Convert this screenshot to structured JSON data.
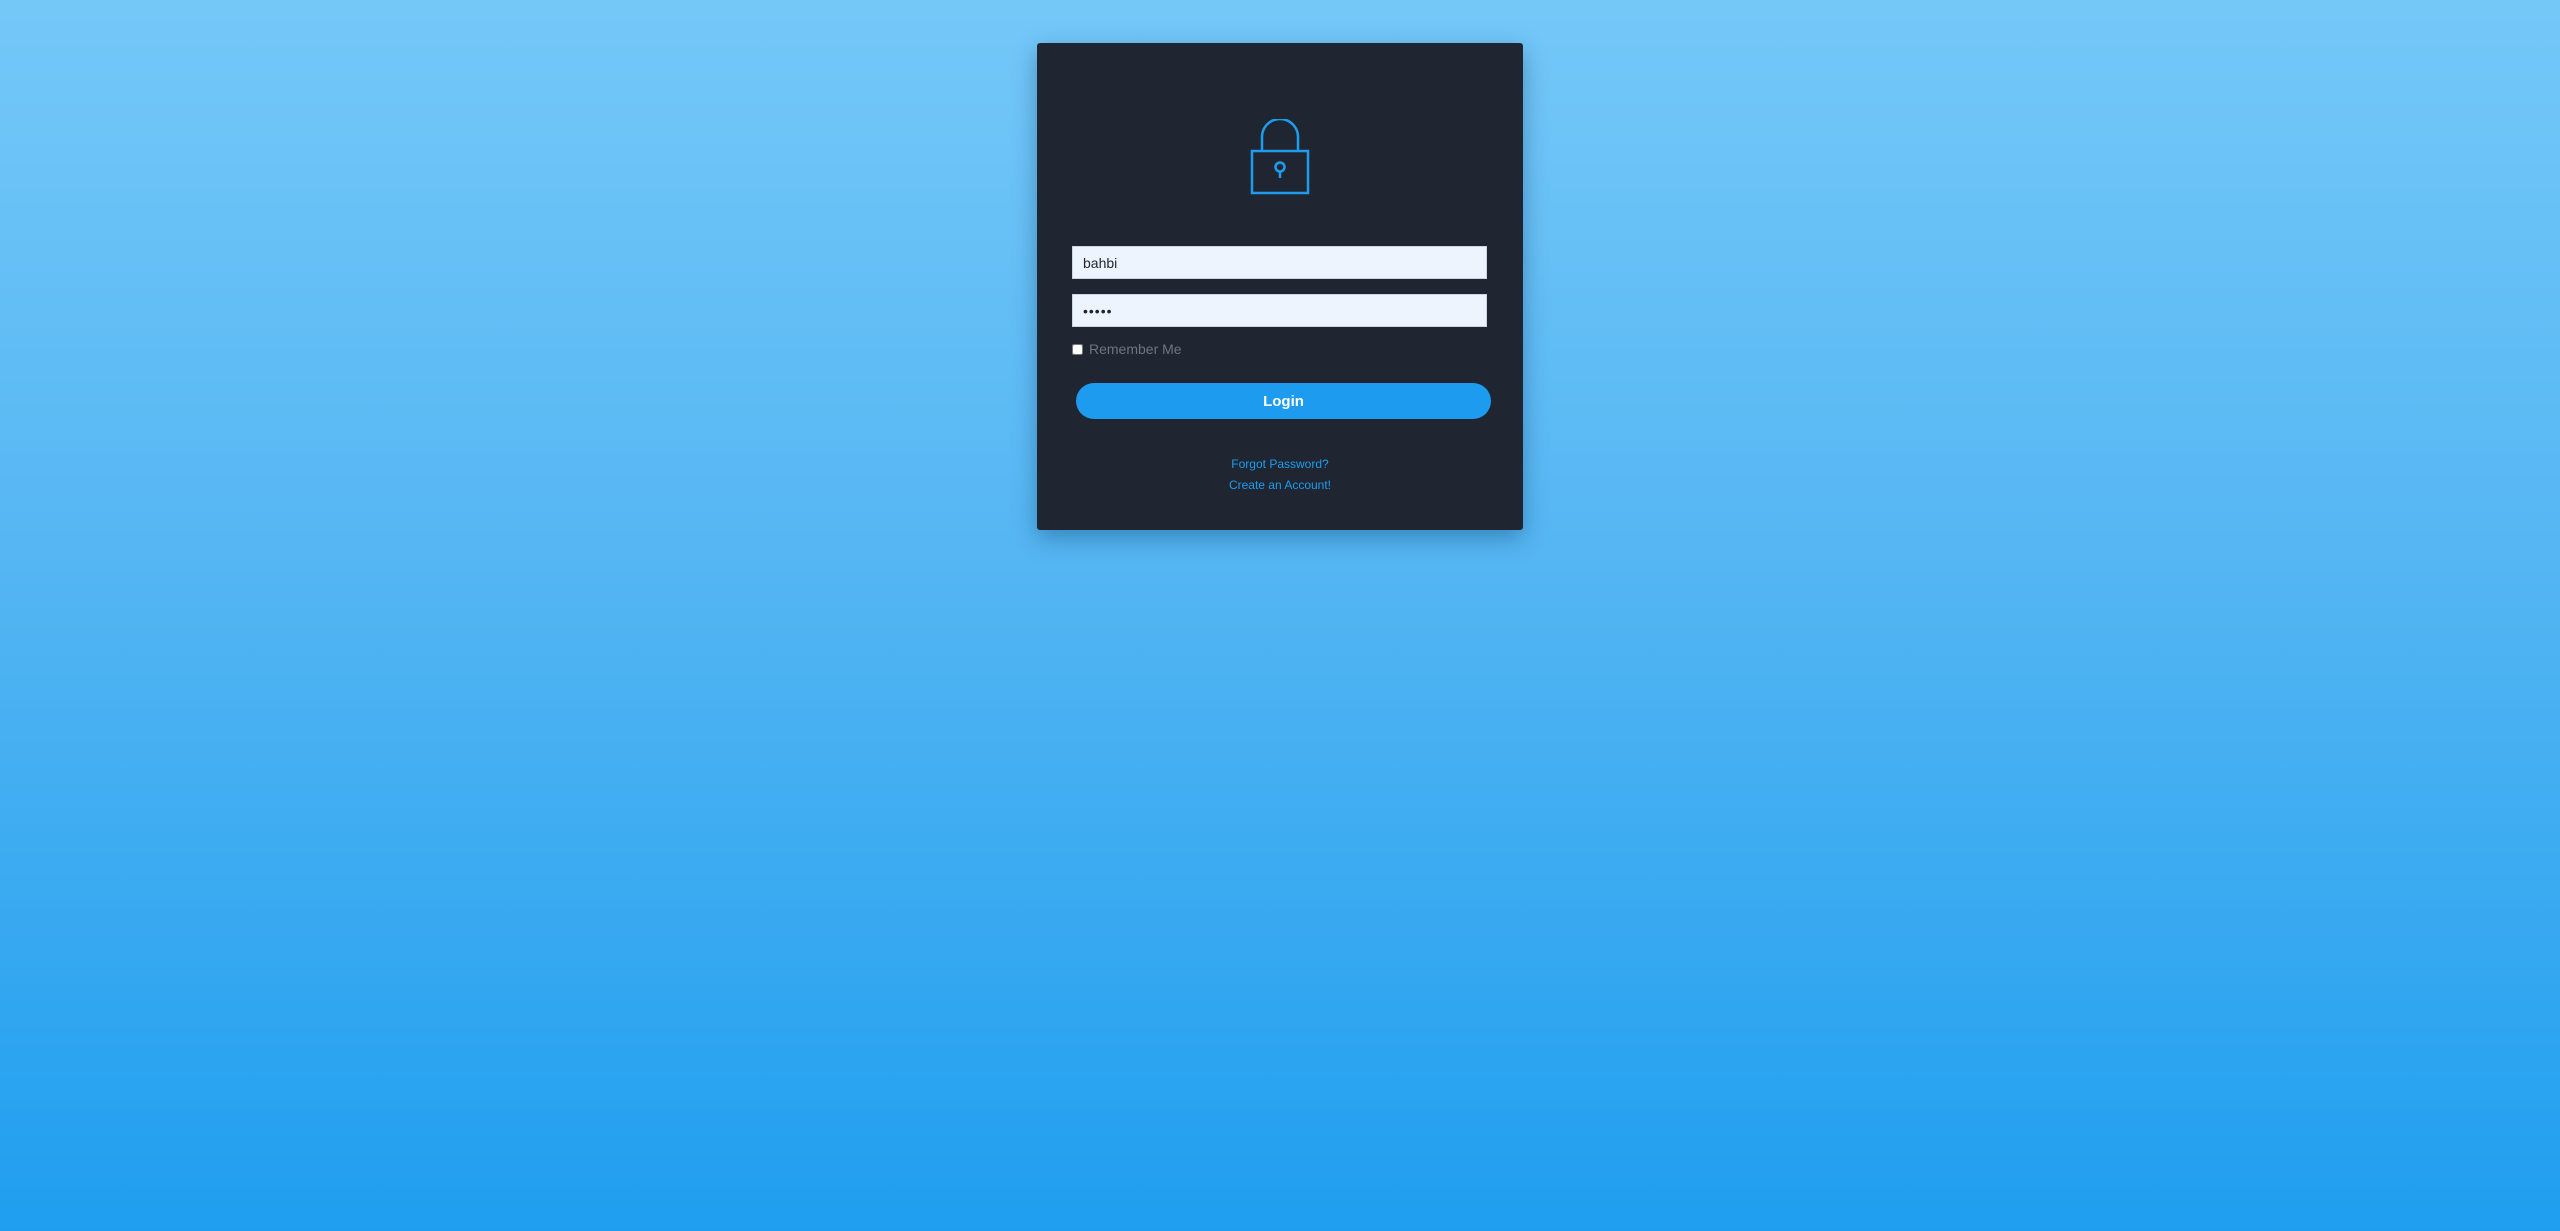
{
  "login": {
    "username_value": "bahbi",
    "password_value": "•••••",
    "remember_label": "Remember Me",
    "login_label": "Login",
    "forgot_link": "Forgot Password?",
    "create_link": "Create an Account!"
  },
  "icons": {
    "lock": "lock-icon"
  },
  "colors": {
    "accent": "#1d9cef",
    "card": "#1f2631",
    "bg_top": "#74c8f8",
    "bg_bottom": "#1f9eef"
  }
}
